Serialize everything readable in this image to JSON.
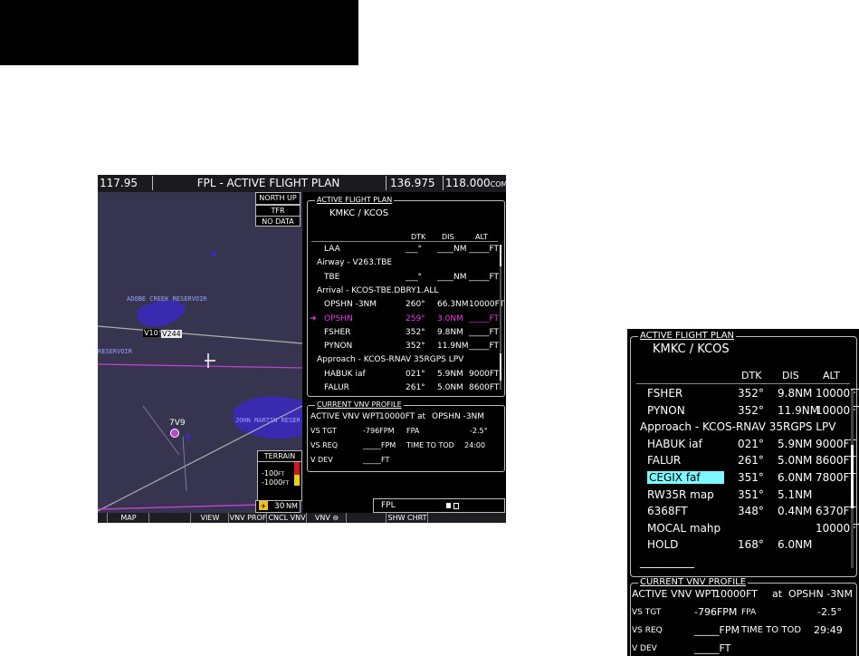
{
  "header_block": "",
  "mfd": {
    "top_bar": {
      "nav_freq": "117.95",
      "page_title": "FPL - ACTIVE FLIGHT PLAN",
      "com_standby": "136.975",
      "com_active": "118.000",
      "com_label": "COM2"
    },
    "map": {
      "orientation": "NORTH UP",
      "tfr_label": "TFR",
      "tfr_status": "NO DATA",
      "labels": {
        "reservoir1": "ADOBE CREEK RESERVOIR",
        "reservoir2": "JOHN MARTIN RESER",
        "airway1": "V10",
        "airway2": "V244",
        "airport": "7V9",
        "left_label": "RESERVOIR"
      },
      "terrain": {
        "title": "TERRAIN",
        "v1": "-100",
        "v1_unit": "FT",
        "v2": "-1000",
        "v2_unit": "FT"
      },
      "range": "30",
      "range_unit": "NM"
    },
    "active_flight_plan": {
      "title": "ACTIVE FLIGHT PLAN",
      "route": "KMKC / KCOS",
      "headers": {
        "dtk": "DTK",
        "dis": "DIS",
        "alt": "ALT"
      },
      "rows": [
        {
          "name": "LAA",
          "dtk": "___°",
          "dis": "____NM",
          "alt": "_____FT"
        },
        {
          "name": "Airway - V263.TBE"
        },
        {
          "name": "TBE",
          "dtk": "___°",
          "dis": "____NM",
          "alt": "_____FT"
        },
        {
          "name": "Arrival - KCOS-TBE.DBRY1.ALL"
        },
        {
          "name": "OPSHN -3NM",
          "dtk": "260°",
          "dis": "66.3NM",
          "alt": "10000FT"
        },
        {
          "name": "OPSHN",
          "dtk": "259°",
          "dis": "3.0NM",
          "alt": "_____FT"
        },
        {
          "name": "FSHER",
          "dtk": "352°",
          "dis": "9.8NM",
          "alt": "_____FT"
        },
        {
          "name": "PYNON",
          "dtk": "352°",
          "dis": "11.9NM",
          "alt": "_____FT"
        },
        {
          "name": "Approach - KCOS-RNAV 35RGPS LPV"
        },
        {
          "name": "HABUK iaf",
          "dtk": "021°",
          "dis": "5.9NM",
          "alt": "9000FT"
        },
        {
          "name": "FALUR",
          "dtk": "261°",
          "dis": "5.0NM",
          "alt": "8600FT"
        }
      ]
    },
    "vnv_profile": {
      "title": "CURRENT VNV PROFILE",
      "wpt_label": "ACTIVE VNV WPT",
      "wpt_alt": "10000FT",
      "wpt_at": "at",
      "wpt_name": "OPSHN -3NM",
      "vs_tgt_label": "VS TGT",
      "vs_tgt": "-796FPM",
      "fpa_label": "FPA",
      "fpa": "-2.5°",
      "vs_req_label": "VS REQ",
      "vs_req": "_____FPM",
      "tod_label": "TIME TO TOD",
      "tod": "24:00",
      "vdev_label": "V DEV",
      "vdev": "_____FT"
    },
    "fpl_tab": "FPL",
    "softkeys": [
      "",
      "MAP",
      "",
      "VIEW",
      "VNV PROF",
      "CNCL VNV",
      "VNV ⊖",
      "",
      "SHW CHRT",
      ""
    ]
  },
  "zoom": {
    "afp": {
      "title": "ACTIVE FLIGHT PLAN",
      "route": "KMKC / KCOS",
      "headers": {
        "dtk": "DTK",
        "dis": "DIS",
        "alt": "ALT"
      },
      "rows": [
        {
          "name": "FSHER",
          "dtk": "352°",
          "dis": "9.8NM",
          "alt": "10000FT"
        },
        {
          "name": "PYNON",
          "dtk": "352°",
          "dis": "11.9NM",
          "alt": "10000FT"
        },
        {
          "name": "Approach - KCOS-RNAV 35RGPS LPV"
        },
        {
          "name": "HABUK iaf",
          "dtk": "021°",
          "dis": "5.9NM",
          "alt": "9000FT"
        },
        {
          "name": "FALUR",
          "dtk": "261°",
          "dis": "5.0NM",
          "alt": "8600FT"
        },
        {
          "name": "CEGIX faf",
          "dtk": "351°",
          "dis": "6.0NM",
          "alt": "7800FT"
        },
        {
          "name": "RW35R map",
          "dtk": "351°",
          "dis": "5.1NM",
          "alt": ""
        },
        {
          "name": "6368FT",
          "dtk": "348°",
          "dis": "0.4NM",
          "alt": "6370FT"
        },
        {
          "name": "MOCAL mahp",
          "dtk": "",
          "dis": "",
          "alt": "10000FT"
        },
        {
          "name": "HOLD",
          "dtk": "168°",
          "dis": "6.0NM",
          "alt": ""
        },
        {
          "name": "__________"
        }
      ]
    },
    "vnv": {
      "title": "CURRENT VNV PROFILE",
      "wpt_label": "ACTIVE VNV WPT",
      "wpt_alt": "10000FT",
      "wpt_at": "at",
      "wpt_name": "OPSHN -3NM",
      "vs_tgt_label": "VS TGT",
      "vs_tgt": "-796FPM",
      "fpa_label": "FPA",
      "fpa": "-2.5°",
      "vs_req_label": "VS REQ",
      "vs_req": "_____FPM",
      "tod_label": "TIME TO TOD",
      "tod": "29:49",
      "vdev_label": "V DEV",
      "vdev": "_____FT"
    }
  },
  "colors": {
    "active_leg": "#e040e0",
    "selected": "#7ef7ff",
    "terrain_yellow": "#e8d020",
    "terrain_red": "#d01818"
  }
}
